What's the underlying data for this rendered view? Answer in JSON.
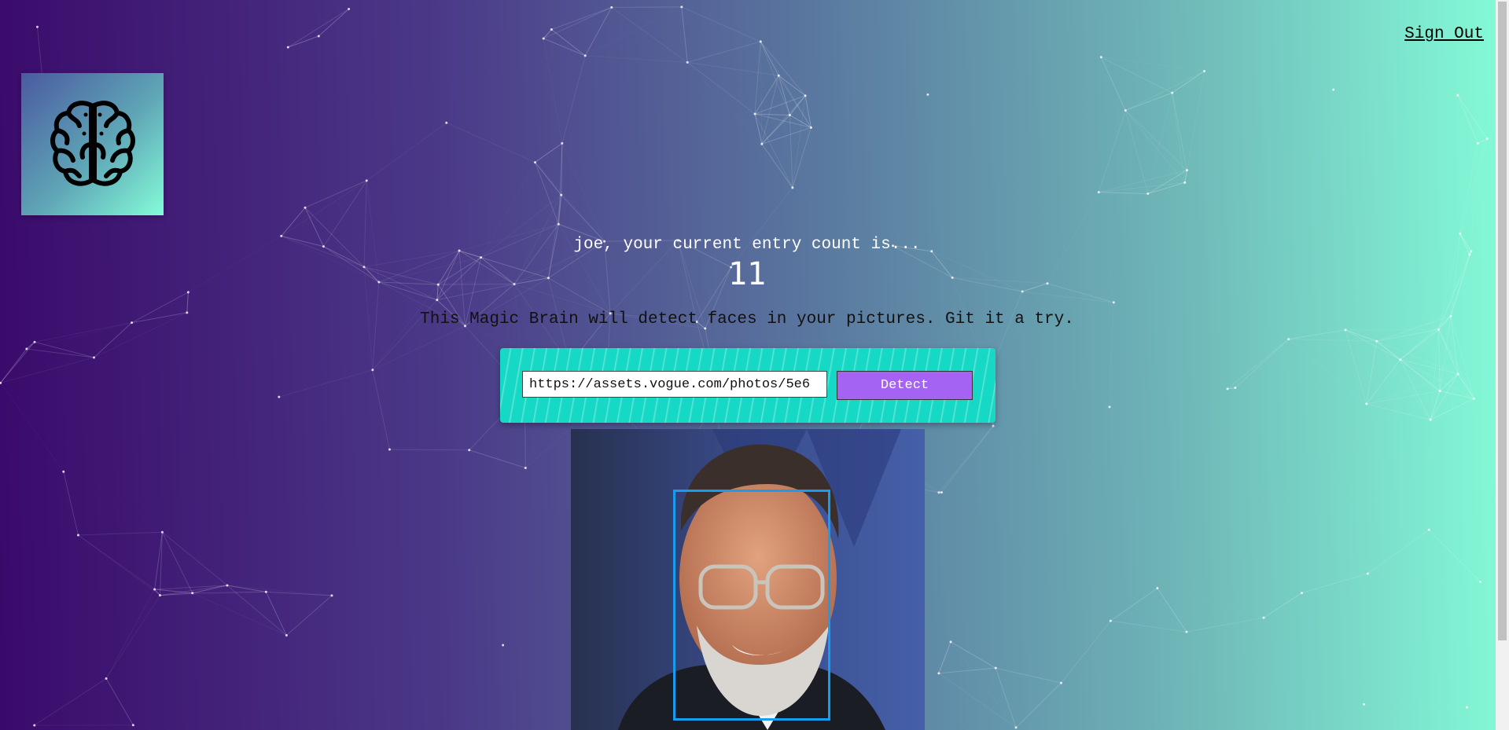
{
  "header": {
    "sign_out_label": "Sign Out"
  },
  "logo": {
    "icon": "brain-icon"
  },
  "rank": {
    "message": "joe, your current entry count is...",
    "count": "11"
  },
  "image_link_form": {
    "description": "This Magic Brain will detect faces in your pictures. Git it a try.",
    "url_value": "https://assets.vogue.com/photos/5e6",
    "detect_label": "Detect"
  },
  "colors": {
    "gradient_start": "#3a0a6b",
    "gradient_end": "#84fcd8",
    "form_panel": "#15d9c4",
    "detect_button": "#a463f2",
    "face_box": "#149df2"
  }
}
